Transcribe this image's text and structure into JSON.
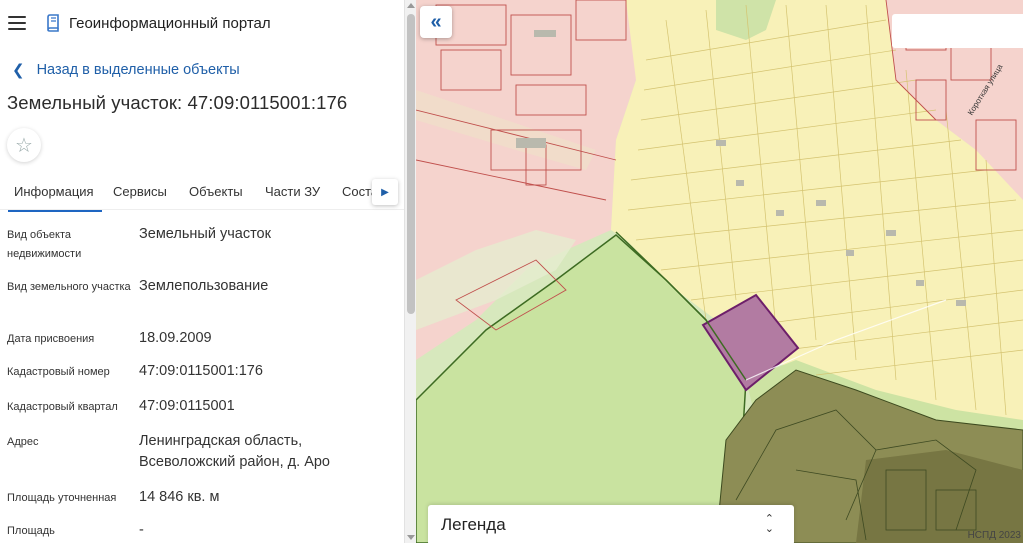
{
  "header": {
    "app_title": "Геоинформационный портал",
    "menu_icon": "hamburger-icon",
    "logo_icon": "portal-logo-icon"
  },
  "back_link": {
    "label": "Назад в выделенные объекты",
    "icon": "chevron-left-icon"
  },
  "object_title": "Земельный участок: 47:09:0115001:176",
  "favorite_icon": "star-outline-icon",
  "tabs": [
    {
      "label": "Информация",
      "active": true
    },
    {
      "label": "Сервисы",
      "active": false
    },
    {
      "label": "Объекты",
      "active": false
    },
    {
      "label": "Части ЗУ",
      "active": false
    },
    {
      "label": "Соста",
      "active": false
    }
  ],
  "properties": [
    {
      "key": "Вид объекта недвижимости",
      "value": "Земельный участок"
    },
    {
      "key": "Вид земельного участка",
      "value": "Землепользование"
    },
    {
      "key": "Дата присвоения",
      "value": "18.09.2009"
    },
    {
      "key": "Кадастровый номер",
      "value": "47:09:0115001:176"
    },
    {
      "key": "Кадастровый квартал",
      "value": "47:09:0115001"
    },
    {
      "key": "Адрес",
      "value": "Ленинградская область, Всеволожский район, д. Аро"
    },
    {
      "key": "Площадь уточненная",
      "value": "14 846 кв. м"
    },
    {
      "key": "Площадь",
      "value": "-"
    }
  ],
  "map": {
    "legend_label": "Легенда",
    "copyright": "НСПД 2023",
    "street_label": "Короткая улица",
    "colors": {
      "forest": "#d4e8b4",
      "cadastre_yellow": "#f7f1b6",
      "cadastre_pink": "#f5cfc9",
      "selected_parcel": "#b27ba2",
      "dark_zone": "#8d8b4f",
      "accent": "#1e66c2"
    }
  }
}
